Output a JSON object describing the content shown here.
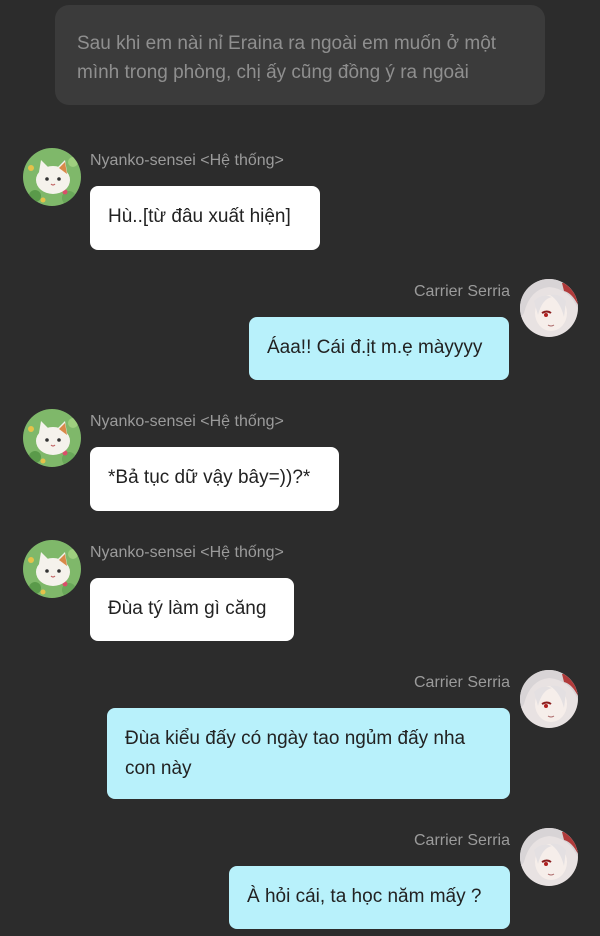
{
  "narration": "Sau khi em nài nỉ Eraina ra ngoài em muốn ở một mình trong phòng, chị ấy cũng đồng ý ra ngoài",
  "messages": [
    {
      "sender": "Nyanko-sensei <Hệ thống>",
      "text": "Hù..[từ đâu xuất hiện]",
      "side": "left",
      "avatar": "cat-avatar"
    },
    {
      "sender": "Carrier Serria",
      "text": "Áaa!! Cái đ.ịt m.ẹ màyyyy",
      "side": "right",
      "avatar": "anime-girl-avatar"
    },
    {
      "sender": "Nyanko-sensei <Hệ thống>",
      "text": "*Bả tục dữ vậy bây=))?*",
      "side": "left",
      "avatar": "cat-avatar"
    },
    {
      "sender": "Nyanko-sensei <Hệ thống>",
      "text": "Đùa tý làm gì căng",
      "side": "left",
      "avatar": "cat-avatar"
    },
    {
      "sender": "Carrier Serria",
      "text": "Đùa kiểu đấy có ngày tao ngủm đấy nha con này",
      "side": "right",
      "avatar": "anime-girl-avatar"
    },
    {
      "sender": "Carrier Serria",
      "text": "À hỏi cái, ta học năm mấy ?",
      "side": "right",
      "avatar": "anime-girl-avatar"
    }
  ],
  "colors": {
    "background": "#2c2c2c",
    "narration_bg": "#3b3b3b",
    "left_bubble": "#ffffff",
    "right_bubble": "#b8f1fb"
  }
}
